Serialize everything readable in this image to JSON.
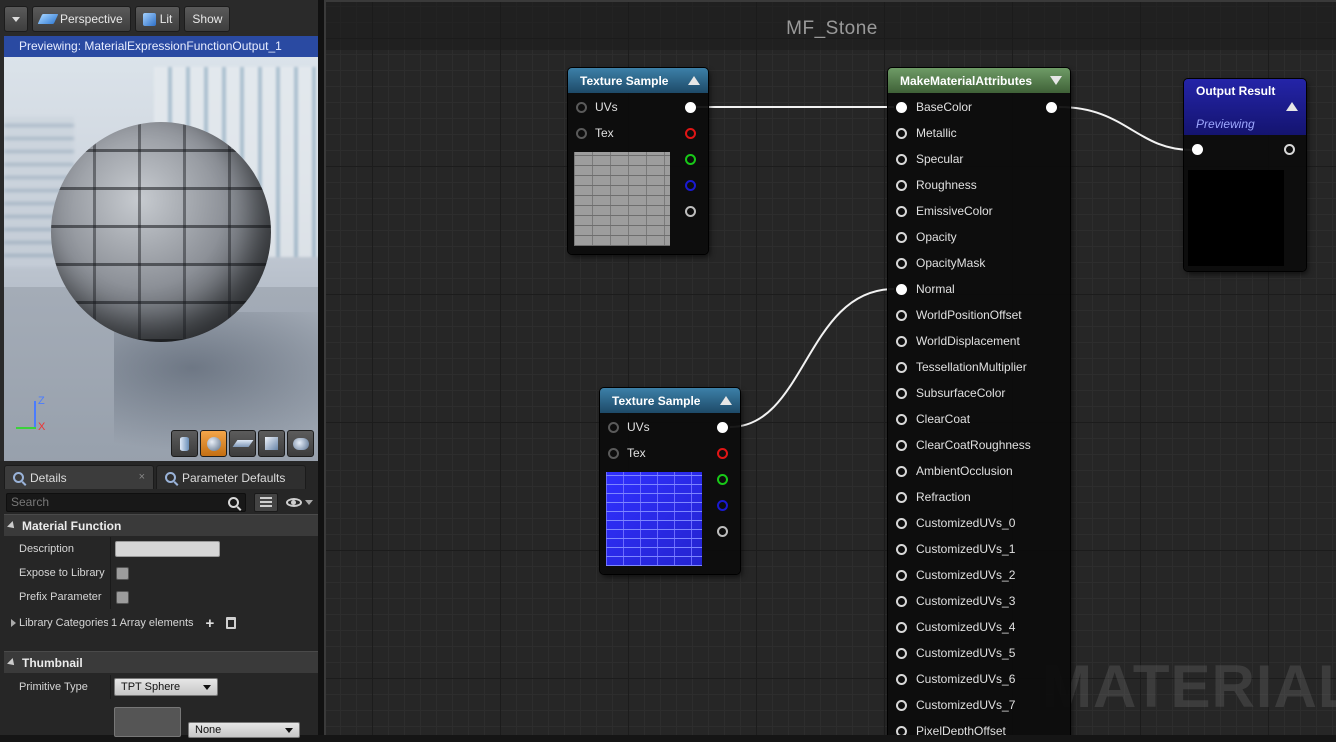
{
  "viewport": {
    "toolbar": {
      "perspective": "Perspective",
      "lit": "Lit",
      "show": "Show"
    },
    "preview_text": "Previewing: MaterialExpressionFunctionOutput_1",
    "axis": {
      "z": "Z",
      "x": "X"
    },
    "primitives": [
      "cylinder-icon",
      "sphere-icon",
      "plane-icon",
      "cube-icon",
      "custom-mesh-icon"
    ],
    "active_primitive": "sphere-icon"
  },
  "details": {
    "tabs": [
      {
        "label": "Details",
        "close": "×"
      },
      {
        "label": "Parameter Defaults"
      }
    ],
    "search": {
      "placeholder": "Search",
      "value": ""
    },
    "material_function": {
      "header": "Material Function",
      "description_label": "Description",
      "expose_label": "Expose to Library",
      "prefix_label": "Prefix Parameter",
      "library_label": "Library Categories",
      "library_value": "1 Array elements"
    },
    "thumbnail": {
      "header": "Thumbnail",
      "primitive_label": "Primitive Type",
      "primitive_value": "TPT Sphere",
      "mesh_value": "None"
    }
  },
  "graph": {
    "title": "MF_Stone",
    "watermark": "MATERIAL F",
    "texture_sample_1": {
      "title": "Texture Sample",
      "inputs": [
        "UVs",
        "Tex"
      ]
    },
    "texture_sample_2": {
      "title": "Texture Sample",
      "inputs": [
        "UVs",
        "Tex"
      ]
    },
    "make_attributes": {
      "title": "MakeMaterialAttributes",
      "inputs": [
        "BaseColor",
        "Metallic",
        "Specular",
        "Roughness",
        "EmissiveColor",
        "Opacity",
        "OpacityMask",
        "Normal",
        "WorldPositionOffset",
        "WorldDisplacement",
        "TessellationMultiplier",
        "SubsurfaceColor",
        "ClearCoat",
        "ClearCoatRoughness",
        "AmbientOcclusion",
        "Refraction",
        "CustomizedUVs_0",
        "CustomizedUVs_1",
        "CustomizedUVs_2",
        "CustomizedUVs_3",
        "CustomizedUVs_4",
        "CustomizedUVs_5",
        "CustomizedUVs_6",
        "CustomizedUVs_7",
        "PixelDepthOffset"
      ],
      "connected": [
        "BaseColor",
        "Normal"
      ]
    },
    "output_result": {
      "title": "Output Result",
      "subtitle": "Previewing"
    }
  },
  "colors": {
    "pin_red": "#e01515",
    "pin_green": "#18c818",
    "pin_blue": "#1a1ad0",
    "texture_header": "#2c6a90",
    "attributes_header": "#5a8552",
    "output_header": "#1c1c8c"
  }
}
